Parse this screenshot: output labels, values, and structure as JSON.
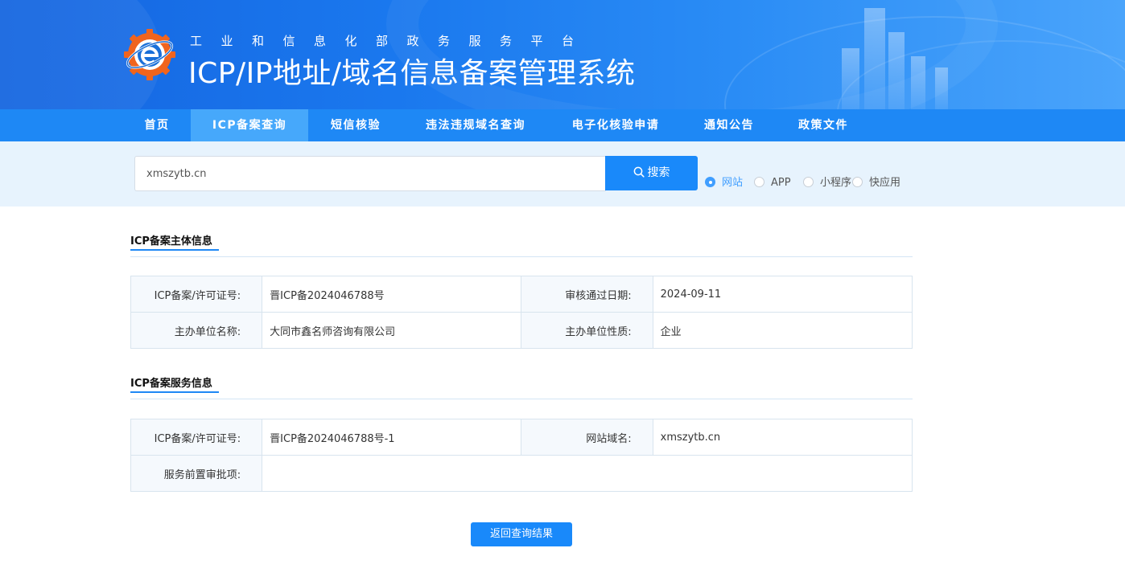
{
  "header": {
    "subtitle": "工业和信息化部政务服务平台",
    "title": "ICP/IP地址/域名信息备案管理系统"
  },
  "nav": {
    "items": [
      {
        "label": "首页",
        "active": false
      },
      {
        "label": "ICP备案查询",
        "active": true
      },
      {
        "label": "短信核验",
        "active": false
      },
      {
        "label": "违法违规域名查询",
        "active": false
      },
      {
        "label": "电子化核验申请",
        "active": false
      },
      {
        "label": "通知公告",
        "active": false
      },
      {
        "label": "政策文件",
        "active": false
      }
    ]
  },
  "search": {
    "value": "xmszytb.cn",
    "button_label": "搜索",
    "types": [
      {
        "label": "网站",
        "checked": true
      },
      {
        "label": "APP",
        "checked": false
      },
      {
        "label": "小程序",
        "checked": false
      },
      {
        "label": "快应用",
        "checked": false
      }
    ]
  },
  "subject": {
    "title": "ICP备案主体信息",
    "license_label": "ICP备案/许可证号:",
    "license_value": "晋ICP备2024046788号",
    "date_label": "审核通过日期:",
    "date_value": "2024-09-11",
    "org_label": "主办单位名称:",
    "org_value": "大同市鑫名师咨询有限公司",
    "nature_label": "主办单位性质:",
    "nature_value": "企业"
  },
  "service": {
    "title": "ICP备案服务信息",
    "license_label": "ICP备案/许可证号:",
    "license_value": "晋ICP备2024046788号-1",
    "domain_label": "网站域名:",
    "domain_value": "xmszytb.cn",
    "approval_label": "服务前置审批项:",
    "approval_value": ""
  },
  "back_button": "返回查询结果",
  "colors": {
    "primary": "#1989fa",
    "nav": "#1e88f5",
    "nav_active": "#46a8fb",
    "search_band": "#e7f3fd"
  }
}
